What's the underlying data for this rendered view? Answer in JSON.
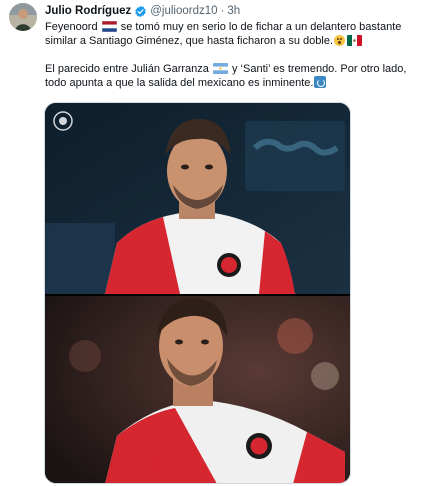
{
  "author": {
    "display_name": "Julio Rodríguez",
    "handle": "@julioordz10",
    "time": "3h",
    "verified_icon": "verified-badge-icon"
  },
  "tweet": {
    "para1": {
      "mention": "Feyenoord",
      "p1": " se tomó muy en serio lo de fichar a un delantero bastante similar a Santiago Giménez,  que hasta ficharon a su doble."
    },
    "para2": {
      "p1": "El parecido entre Julián Garranza ",
      "p2": " y ‘Santi’ es tremendo. Por otro lado, todo apunta a que la salida del mexicano es inminente."
    }
  },
  "emojis": {
    "netherlands": "netherlands-flag-icon",
    "flushed": "flushed-face-icon",
    "mexico": "mexico-flag-icon",
    "argentina": "argentina-flag-icon",
    "loop": "repeat-loop-icon"
  },
  "colors": {
    "feyenoord_red": "#d6262f",
    "text": "#0f1419",
    "secondary_text": "#536471",
    "verified_blue": "#1d9bf0",
    "border": "#cfd9de"
  }
}
